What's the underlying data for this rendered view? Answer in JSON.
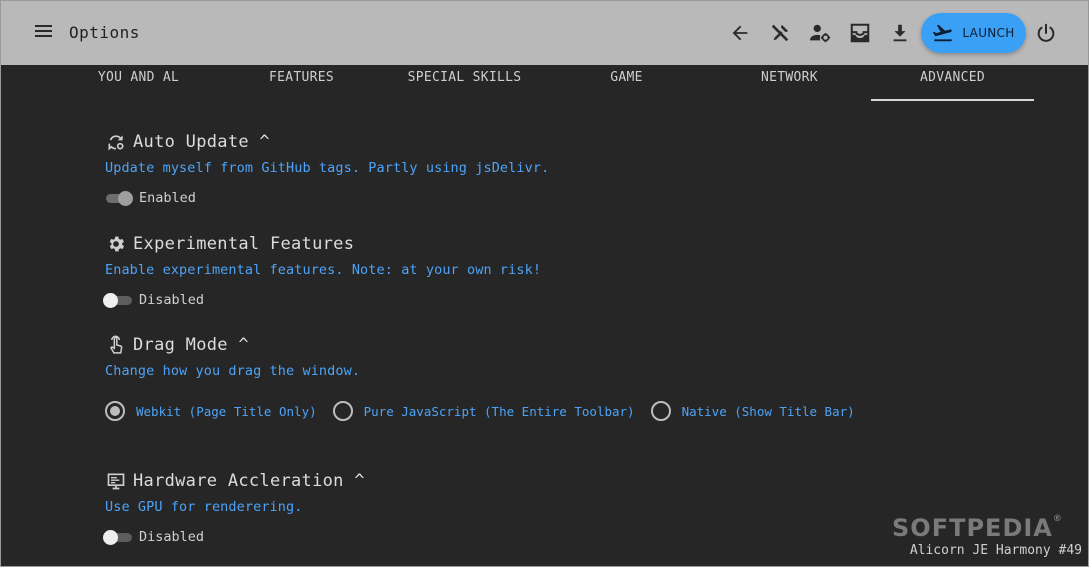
{
  "header": {
    "title": "Options",
    "launch_label": "LAUNCH",
    "icons": [
      "menu-icon",
      "back-arrow-icon",
      "tools-icon",
      "account-settings-icon",
      "inbox-icon",
      "download-icon",
      "airplane-takeoff-icon",
      "power-icon"
    ]
  },
  "tabs": [
    {
      "label": "YOU AND AL"
    },
    {
      "label": "FEATURES"
    },
    {
      "label": "SPECIAL SKILLS"
    },
    {
      "label": "GAME"
    },
    {
      "label": "NETWORK"
    },
    {
      "label": "ADVANCED",
      "active": true
    }
  ],
  "settings": {
    "auto_update": {
      "title": "Auto Update ^",
      "desc": "Update myself from GitHub tags. Partly using jsDelivr.",
      "state_label": "Enabled",
      "enabled": true
    },
    "experimental": {
      "title": "Experimental Features",
      "desc": "Enable experimental features. Note: at your own risk!",
      "state_label": "Disabled",
      "enabled": false
    },
    "drag_mode": {
      "title": "Drag Mode ^",
      "desc": "Change how you drag the window.",
      "options": [
        {
          "label": "Webkit (Page Title Only)",
          "selected": true
        },
        {
          "label": "Pure JavaScript (The Entire Toolbar)",
          "selected": false
        },
        {
          "label": "Native (Show Title Bar)",
          "selected": false
        }
      ]
    },
    "hardware": {
      "title": "Hardware Accleration ^",
      "desc": "Use GPU for renderering.",
      "state_label": "Disabled",
      "enabled": false
    }
  },
  "footer": {
    "watermark": "SOFTPEDIA",
    "watermark_mark": "®",
    "version": "Alicorn JE Harmony #49"
  },
  "colors": {
    "header_bg": "#b9b9b9",
    "body_bg": "#262626",
    "accent": "#3aa0f5",
    "link_text": "#4da3f7"
  }
}
